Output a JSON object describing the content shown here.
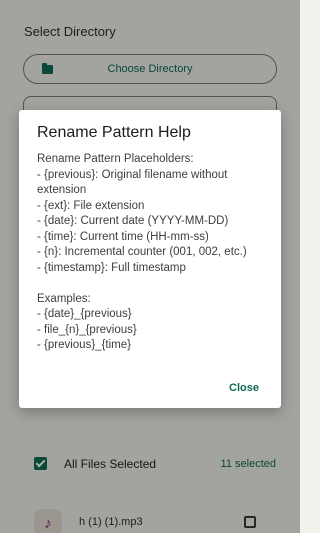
{
  "screen": {
    "section_title": "Select Directory",
    "choose_button_label": "Choose Directory",
    "files_header_label": "All Files Selected",
    "files_selected_count": "11 selected",
    "file_item_name": "h (1) (1).mp3",
    "file_item_icon": "music-note-icon"
  },
  "dialog": {
    "title": "Rename Pattern Help",
    "heading": "Rename Pattern Placeholders:",
    "placeholders": [
      "- {previous}: Original filename without extension",
      "- {ext}: File extension",
      "- {date}: Current date (YYYY-MM-DD)",
      "- {time}: Current time (HH-mm-ss)",
      "- {n}: Incremental counter (001, 002, etc.)",
      "- {timestamp}: Full timestamp"
    ],
    "examples_heading": "Examples:",
    "examples": [
      "- {date}_{previous}",
      "- file_{n}_{previous}",
      "- {previous}_{time}"
    ],
    "close_label": "Close"
  },
  "colors": {
    "accent": "#0f6b52",
    "background": "#f1f2ec"
  }
}
